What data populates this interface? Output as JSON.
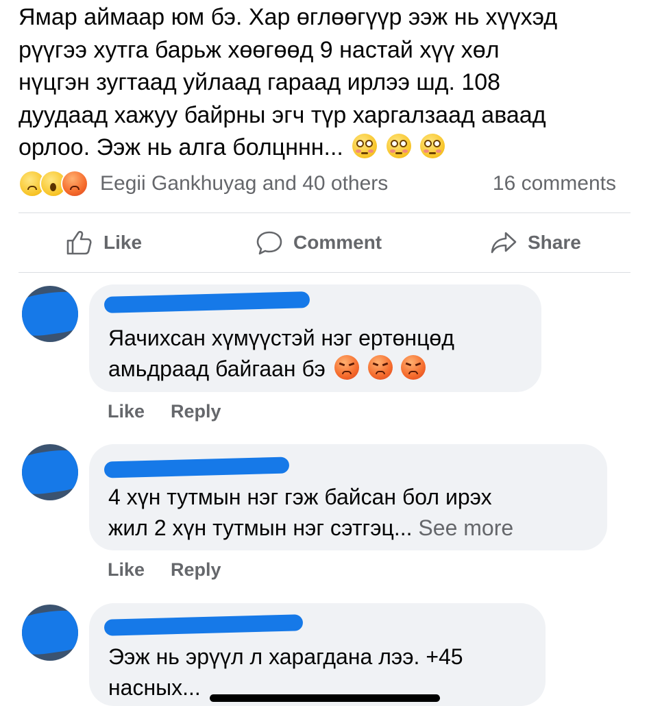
{
  "post": {
    "text_lines": [
      "Ямар аймаар юм бэ. Хар өглөөгүүр ээж нь хүүхэд",
      "рүүгээ хутга барьж хөөгөөд 9 настай хүү хөл",
      "нүцгэн зугтаад уйлаад гараад ирлээ шд. 108",
      "дуудаад хажуу байрны эгч түр харгалзаад аваад",
      "орлоо. Ээж нь алга болцннн..."
    ],
    "trailing_emojis": [
      "flushed-face",
      "flushed-face",
      "flushed-face"
    ]
  },
  "reactions": {
    "icons": [
      "sad",
      "wow",
      "angry"
    ],
    "summary": "Eegii Gankhuyag and 40 others",
    "comments_count": "16 comments"
  },
  "actions": {
    "like": "Like",
    "comment": "Comment",
    "share": "Share"
  },
  "comments": [
    {
      "text_line1": "Яачихсан хүмүүстэй нэг ертөнцөд",
      "text_line2": "амьдраад байгаан бэ",
      "trailing_emojis": [
        "angry-face",
        "angry-face",
        "angry-face"
      ],
      "like": "Like",
      "reply": "Reply"
    },
    {
      "text_line1": "4 хүн тутмын нэг гэж байсан бол ирэх",
      "text_line2": "жил 2 хүн тутмын нэг сэтгэц...",
      "see_more": "See more",
      "like": "Like",
      "reply": "Reply"
    },
    {
      "text_line1": "Ээж нь эрүүл л харагдана лээ. +45",
      "text_line2": "насных..."
    }
  ],
  "colors": {
    "text": "#050505",
    "secondary": "#65676b",
    "bubble": "#f0f2f5",
    "redaction": "#1679e8"
  }
}
